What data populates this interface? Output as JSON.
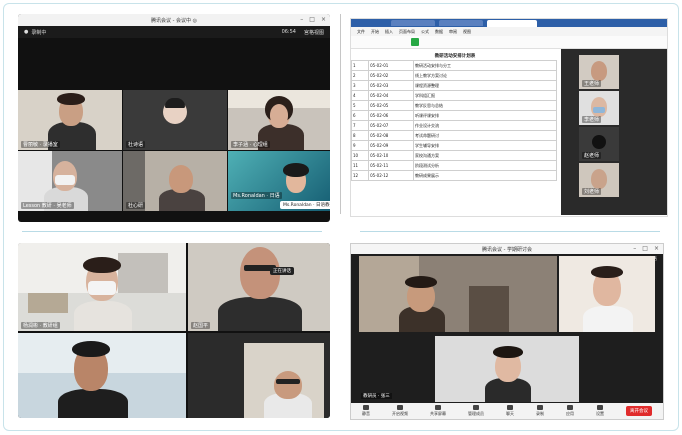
{
  "panels": {
    "top_left": {
      "window_title": "腾讯会议 - 会议中 ◎",
      "recording_badge": "录制中",
      "timer": "06:54",
      "layout_label": "宫格视图",
      "participants": [
        {
          "name": "曹丽敏 · 录播室"
        },
        {
          "name": "杜诗语"
        },
        {
          "name": "李子涵 · 心理组"
        },
        {
          "name": "Lesson 教研 · 吴老师"
        },
        {
          "name": "杜心研"
        },
        {
          "name": "Ms.Ronaldan · 日语"
        }
      ],
      "popup_text": "Ms.Ronaldan · 日语教研"
    },
    "top_right": {
      "ribbon_tabs": [
        "文件",
        "开始",
        "插入",
        "页面布局",
        "公式",
        "数据",
        "审阅",
        "视图"
      ],
      "sheet_title": "教研活动安排计划表",
      "rows": [
        {
          "no": "1",
          "date": "05-02-01",
          "content": "教研活动安排与分工"
        },
        {
          "no": "2",
          "date": "05-02-02",
          "content": "线上教学方案讨论"
        },
        {
          "no": "3",
          "date": "05-02-03",
          "content": "课程资源整理"
        },
        {
          "no": "4",
          "date": "05-02-04",
          "content": "学科组汇报"
        },
        {
          "no": "5",
          "date": "05-02-05",
          "content": "教学反思与总结"
        },
        {
          "no": "6",
          "date": "05-02-06",
          "content": "听课评课安排"
        },
        {
          "no": "7",
          "date": "05-02-07",
          "content": "作业设计交流"
        },
        {
          "no": "8",
          "date": "05-02-08",
          "content": "考试命题研讨"
        },
        {
          "no": "9",
          "date": "05-02-09",
          "content": "学生辅导安排"
        },
        {
          "no": "10",
          "date": "05-02-10",
          "content": "家校沟通方案"
        },
        {
          "no": "11",
          "date": "05-02-11",
          "content": "阶段测试分析"
        },
        {
          "no": "12",
          "date": "05-02-12",
          "content": "教研成果展示"
        }
      ],
      "side_names": [
        "王老师",
        "李老师",
        "赵老师",
        "刘老师"
      ]
    },
    "bottom_left": {
      "participants": [
        {
          "name": "杨润彬 · 教研组"
        },
        {
          "name": "赵国平"
        },
        {
          "name": ""
        },
        {
          "name": ""
        }
      ],
      "popup_text": "正在讲话"
    },
    "bottom_right": {
      "window_title": "腾讯会议 - 学期研讨会",
      "top_badge": "宫格",
      "presenter_tag": "教研员 · 张三",
      "controls": [
        "静音",
        "开启视频",
        "共享屏幕",
        "管理成员",
        "聊天",
        "录制",
        "应用",
        "设置"
      ],
      "leave_button": "离开会议"
    }
  }
}
